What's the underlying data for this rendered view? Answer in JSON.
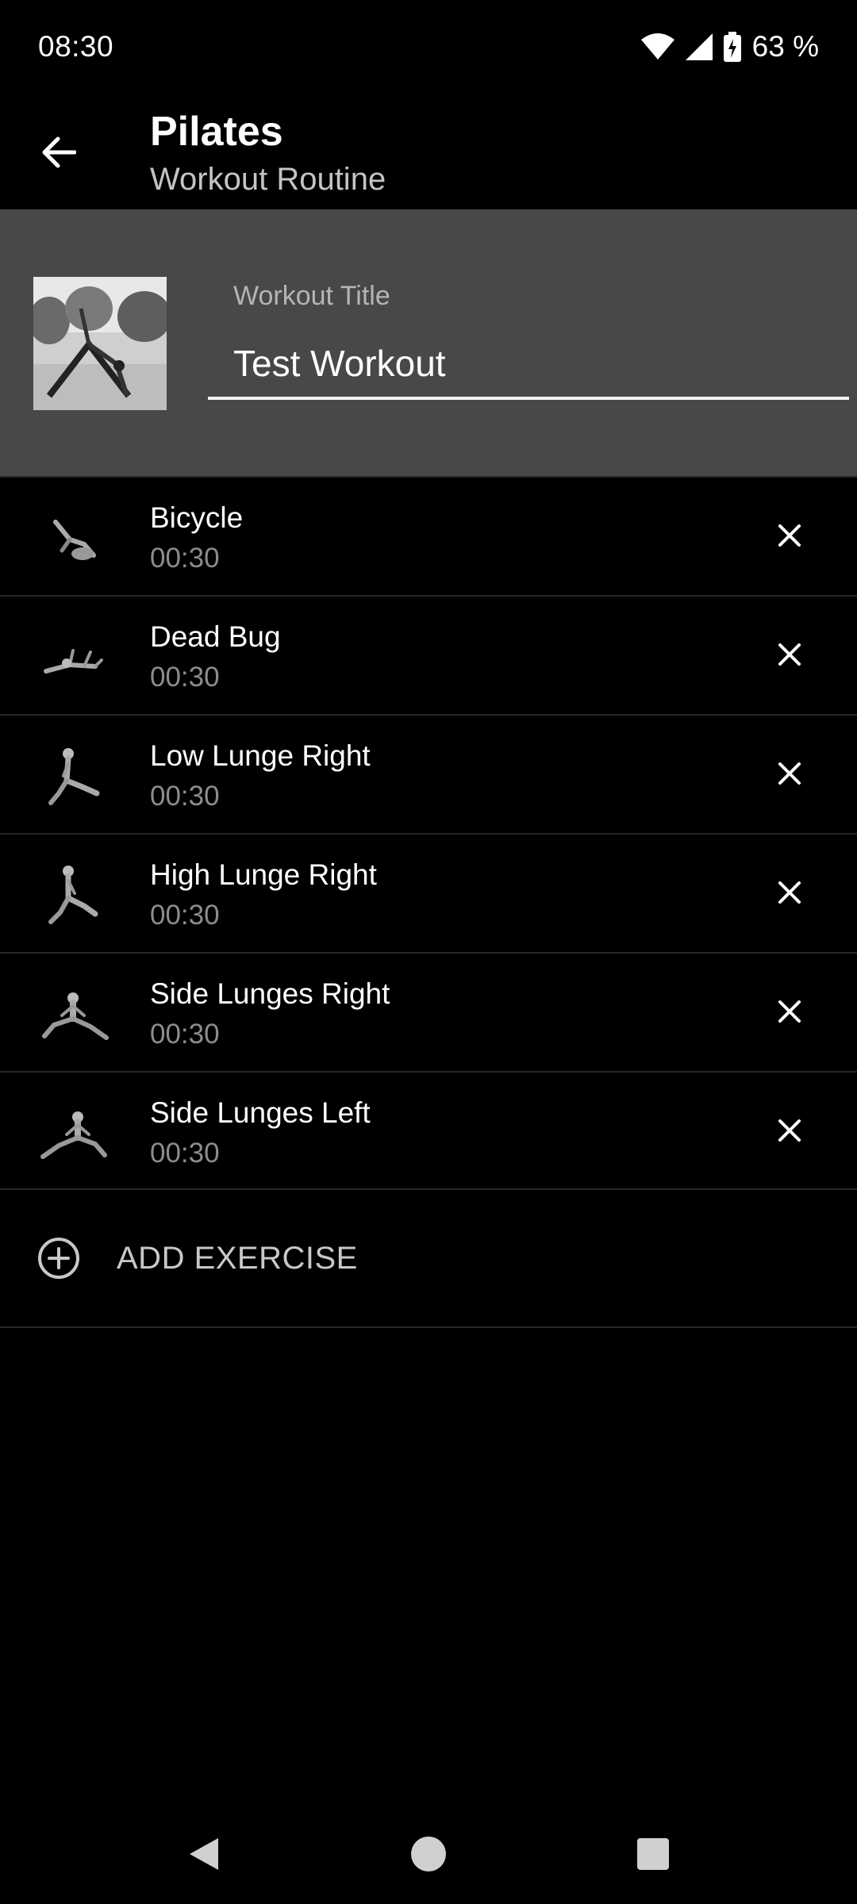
{
  "status_bar": {
    "time": "08:30",
    "battery": "63 %",
    "icons": [
      "wifi-icon",
      "signal-icon",
      "battery-charging-icon"
    ]
  },
  "toolbar": {
    "title": "Pilates",
    "subtitle": "Workout Routine",
    "back_icon": "arrow-left-icon"
  },
  "header": {
    "title_label": "Workout Title",
    "title_value": "Test Workout"
  },
  "exercises": [
    {
      "name": "Bicycle",
      "duration": "00:30"
    },
    {
      "name": "Dead Bug",
      "duration": "00:30"
    },
    {
      "name": "Low Lunge Right",
      "duration": "00:30"
    },
    {
      "name": "High Lunge Right",
      "duration": "00:30"
    },
    {
      "name": "Side Lunges Right",
      "duration": "00:30"
    },
    {
      "name": "Side Lunges Left",
      "duration": "00:30"
    }
  ],
  "add_exercise": {
    "label": "ADD EXERCISE",
    "icon": "add-circle-icon"
  },
  "nav_bar": {
    "icons": [
      "nav-back-icon",
      "nav-home-icon",
      "nav-recents-icon"
    ]
  },
  "colors": {
    "background": "#000000",
    "header_panel": "#484848",
    "secondary_text": "#8c8c8c",
    "divider": "#262626"
  }
}
